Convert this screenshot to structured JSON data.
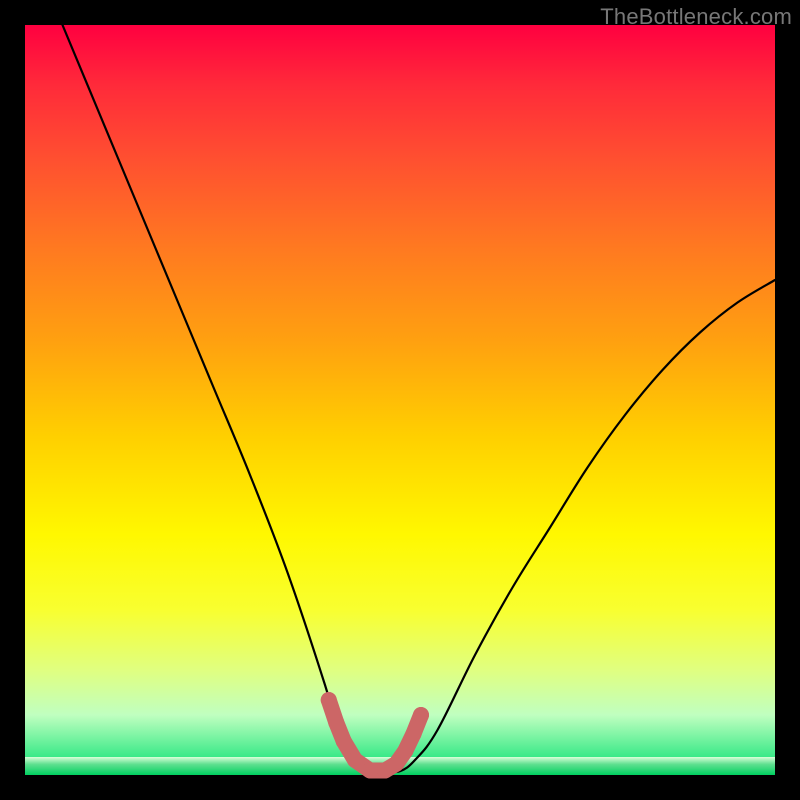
{
  "watermark": "TheBottleneck.com",
  "colors": {
    "frame_bg": "#000000",
    "curve_stroke": "#000000",
    "marker_stroke": "#cc6666",
    "marker_fill": "#cc6666"
  },
  "chart_data": {
    "type": "line",
    "title": "",
    "xlabel": "",
    "ylabel": "",
    "xlim": [
      0,
      100
    ],
    "ylim": [
      0,
      100
    ],
    "grid": false,
    "legend": false,
    "series": [
      {
        "name": "curve",
        "x": [
          5,
          10,
          15,
          20,
          25,
          30,
          35,
          40,
          42,
          44,
          46,
          48,
          50,
          52,
          55,
          60,
          65,
          70,
          75,
          80,
          85,
          90,
          95,
          100
        ],
        "values": [
          100,
          88,
          76,
          64,
          52,
          40,
          27,
          12,
          5,
          2,
          0.5,
          0.5,
          0.5,
          2,
          6,
          16,
          25,
          33,
          41,
          48,
          54,
          59,
          63,
          66
        ]
      }
    ],
    "markers": {
      "name": "highlighted-valley",
      "x": [
        40.5,
        41.5,
        42.5,
        44,
        46,
        48,
        49.5,
        50.7,
        51.8,
        52.8
      ],
      "values": [
        10,
        7,
        4.5,
        2,
        0.6,
        0.6,
        1.5,
        3.2,
        5.5,
        8
      ]
    }
  }
}
